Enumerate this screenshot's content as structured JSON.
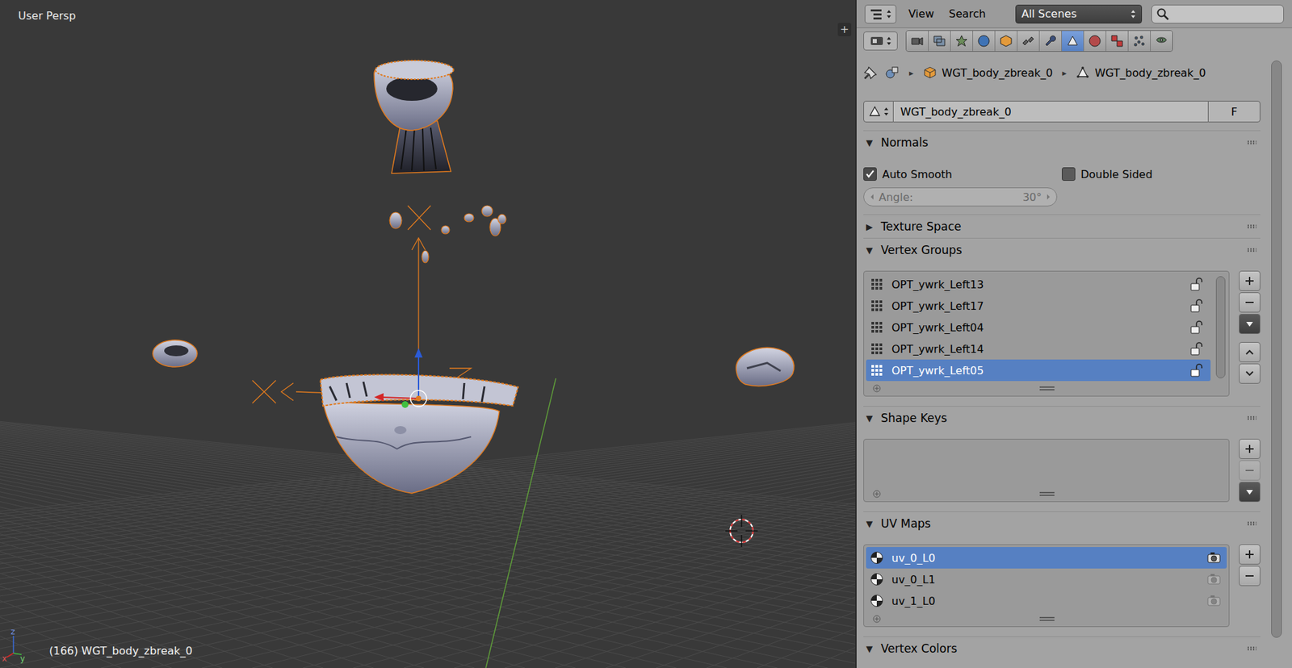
{
  "viewport": {
    "view_label": "User Persp",
    "object_info": "(166) WGT_body_zbreak_0",
    "toggle": "+",
    "axes": [
      "x",
      "y",
      "z"
    ]
  },
  "header": {
    "menus": [
      "View",
      "Search"
    ],
    "scene_filter": "All Scenes"
  },
  "property_tabs": [
    {
      "selected": false
    },
    {
      "selected": false
    },
    {
      "selected": false
    },
    {
      "selected": false
    },
    {
      "selected": false
    },
    {
      "selected": false
    },
    {
      "selected": false
    },
    {
      "selected": true
    },
    {
      "selected": false
    },
    {
      "selected": false
    },
    {
      "selected": false
    },
    {
      "selected": false
    }
  ],
  "breadcrumb": {
    "separator": "▸",
    "items": [
      "WGT_body_zbreak_0",
      "WGT_body_zbreak_0"
    ]
  },
  "datablock": {
    "name": "WGT_body_zbreak_0",
    "fake_user": "F"
  },
  "normals": {
    "title": "Normals",
    "expander": "▼",
    "expanded": true,
    "options": [
      {
        "label": "Auto Smooth",
        "checked": true
      },
      {
        "label": "Double Sided",
        "checked": false
      }
    ],
    "angle": {
      "label": "Angle:",
      "value": "30°",
      "disabled": true
    }
  },
  "texture_space": {
    "title": "Texture Space",
    "expander": "▶",
    "expanded": false
  },
  "vertex_groups": {
    "title": "Vertex Groups",
    "expander": "▼",
    "expanded": true,
    "items": [
      {
        "name": "OPT_ywrk_Left13",
        "locked": false,
        "selected": false
      },
      {
        "name": "OPT_ywrk_Left17",
        "locked": false,
        "selected": false
      },
      {
        "name": "OPT_ywrk_Left04",
        "locked": false,
        "selected": false
      },
      {
        "name": "OPT_ywrk_Left14",
        "locked": false,
        "selected": false
      },
      {
        "name": "OPT_ywrk_Left05",
        "locked": false,
        "selected": true
      }
    ],
    "buttons": [
      {
        "kind": "add",
        "disabled": false
      },
      {
        "kind": "remove",
        "disabled": false
      },
      {
        "kind": "specials",
        "disabled": false
      },
      {
        "kind": "up",
        "disabled": false
      },
      {
        "kind": "down",
        "disabled": false
      }
    ]
  },
  "shape_keys": {
    "title": "Shape Keys",
    "expander": "▼",
    "expanded": true,
    "items": [],
    "buttons": [
      {
        "kind": "add",
        "disabled": false
      },
      {
        "kind": "remove",
        "disabled": true
      },
      {
        "kind": "specials",
        "disabled": false
      }
    ]
  },
  "uv_maps": {
    "title": "UV Maps",
    "expander": "▼",
    "expanded": true,
    "items": [
      {
        "name": "uv_0_L0",
        "selected": true,
        "render_active": true
      },
      {
        "name": "uv_0_L1",
        "selected": false,
        "render_active": false
      },
      {
        "name": "uv_1_L0",
        "selected": false,
        "render_active": false
      }
    ],
    "buttons": [
      {
        "kind": "add",
        "disabled": false
      },
      {
        "kind": "remove",
        "disabled": false
      }
    ]
  },
  "vertex_colors": {
    "title": "Vertex Colors",
    "expander": "▼",
    "expanded": true
  },
  "scrollbar": {
    "level": 0.95
  }
}
